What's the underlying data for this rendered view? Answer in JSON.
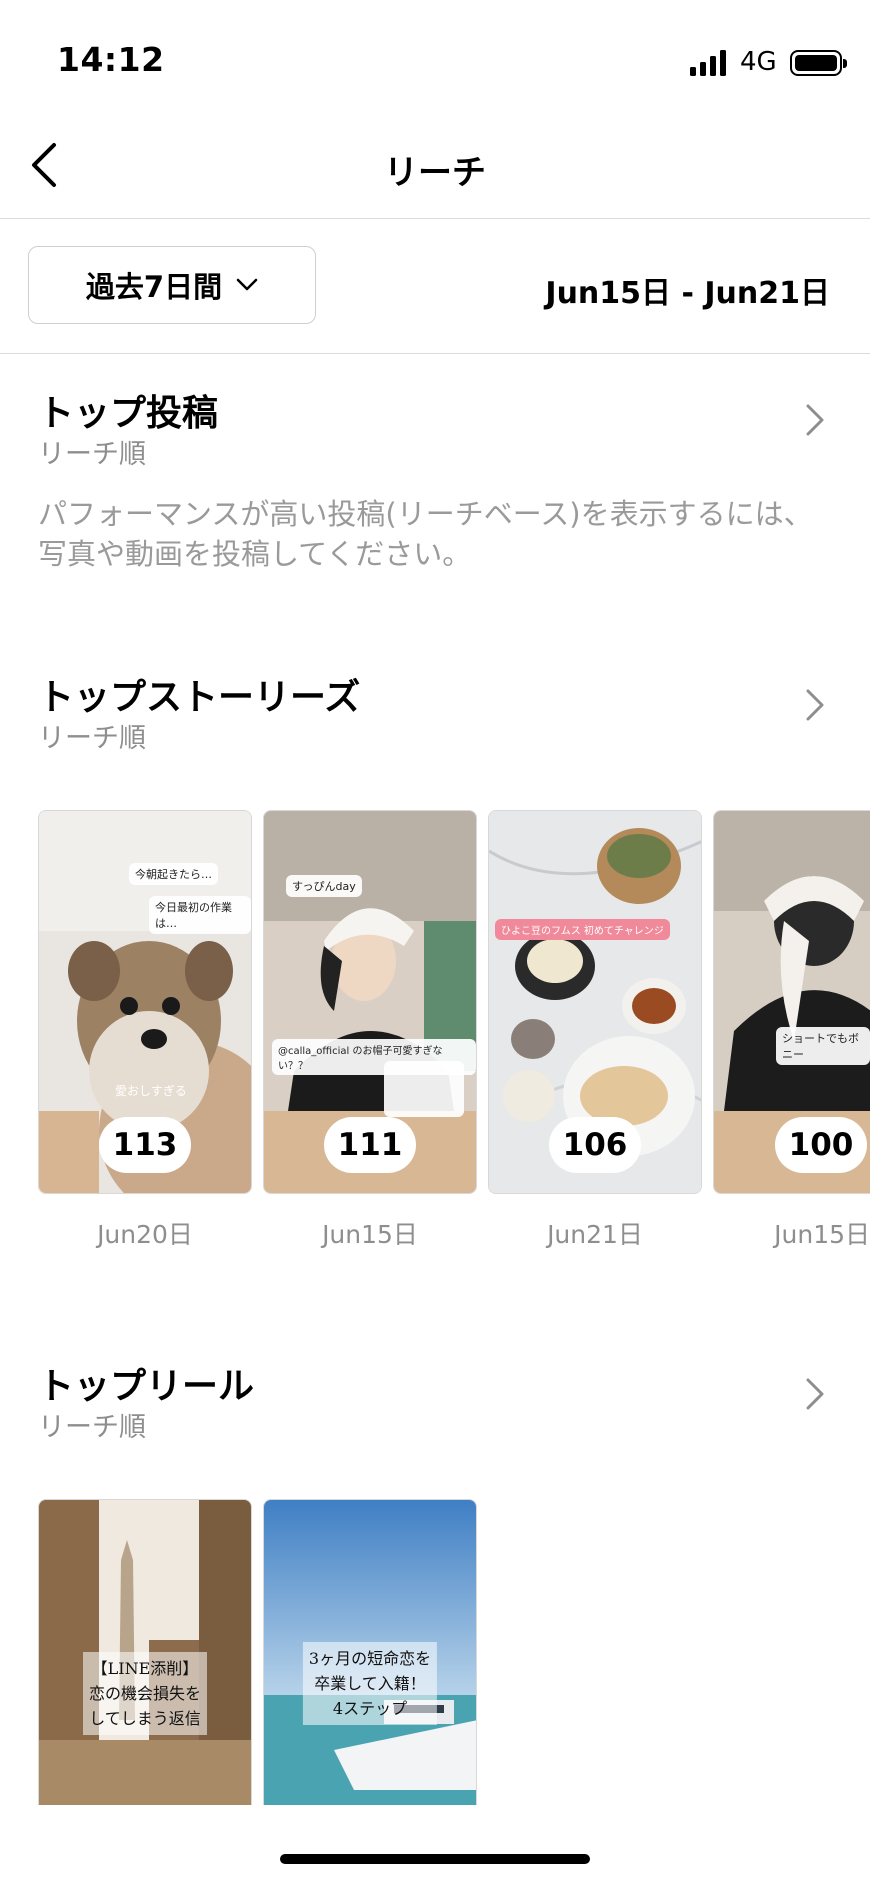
{
  "status_bar": {
    "time": "14:12",
    "network": "4G"
  },
  "header": {
    "title": "リーチ"
  },
  "filter": {
    "period_label": "過去7日間",
    "date_range": "Jun15日 - Jun21日"
  },
  "top_posts": {
    "title": "トップ投稿",
    "subtitle": "リーチ順",
    "empty_message": "パフォーマンスが高い投稿(リーチベース)を表示するには、写真や動画を投稿してください。"
  },
  "top_stories": {
    "title": "トップストーリーズ",
    "subtitle": "リーチ順",
    "items": [
      {
        "count": "113",
        "date": "Jun20日",
        "overlay_text": "愛おしすぎる"
      },
      {
        "count": "111",
        "date": "Jun15日",
        "overlay_text": "すっぴんday"
      },
      {
        "count": "106",
        "date": "Jun21日",
        "overlay_text": "ひよこ豆のフムス 初めてチャレンジ"
      },
      {
        "count": "100",
        "date": "Jun15日",
        "overlay_text": "ショートでもボニー"
      }
    ]
  },
  "top_reels": {
    "title": "トップリール",
    "subtitle": "リーチ順",
    "items": [
      {
        "caption": "【LINE添削】\n恋の機会損失を\nしてしまう返信"
      },
      {
        "caption": "3ヶ月の短命恋を\n卒業して入籍！\n4ステップ"
      }
    ]
  }
}
